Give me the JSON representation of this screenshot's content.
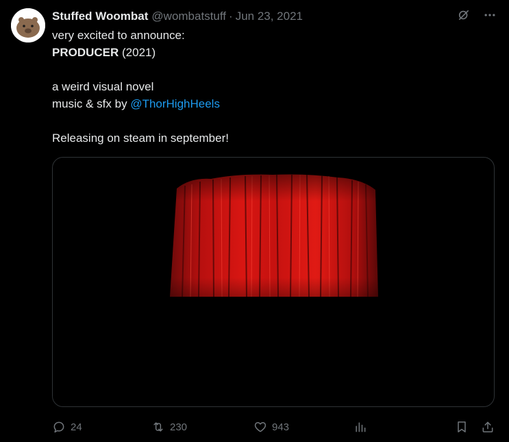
{
  "author": {
    "display_name": "Stuffed Woombat",
    "handle": "@wombatstuff",
    "separator": "·",
    "date": "Jun 23, 2021"
  },
  "tweet": {
    "line1": "very excited to announce:",
    "line2_bold": "PRODUCER",
    "line2_rest": " (2021)",
    "line3": "a weird visual novel",
    "line4_prefix": "music & sfx by ",
    "line4_mention": "@ThorHighHeels",
    "line5": "Releasing on steam in september!"
  },
  "media": {
    "description_icon": "red-curtain-image"
  },
  "actions": {
    "replies": "24",
    "retweets": "230",
    "likes": "943"
  },
  "icons": {
    "grok": "grok-icon",
    "more": "more-icon",
    "reply": "reply-icon",
    "retweet": "retweet-icon",
    "like": "heart-icon",
    "views": "views-icon",
    "bookmark": "bookmark-icon",
    "share": "share-icon"
  },
  "colors": {
    "background": "#000000",
    "text": "#e7e9ea",
    "muted": "#71767b",
    "link": "#1d9bf0",
    "border": "#2f3336",
    "curtain": "#c0100f"
  }
}
